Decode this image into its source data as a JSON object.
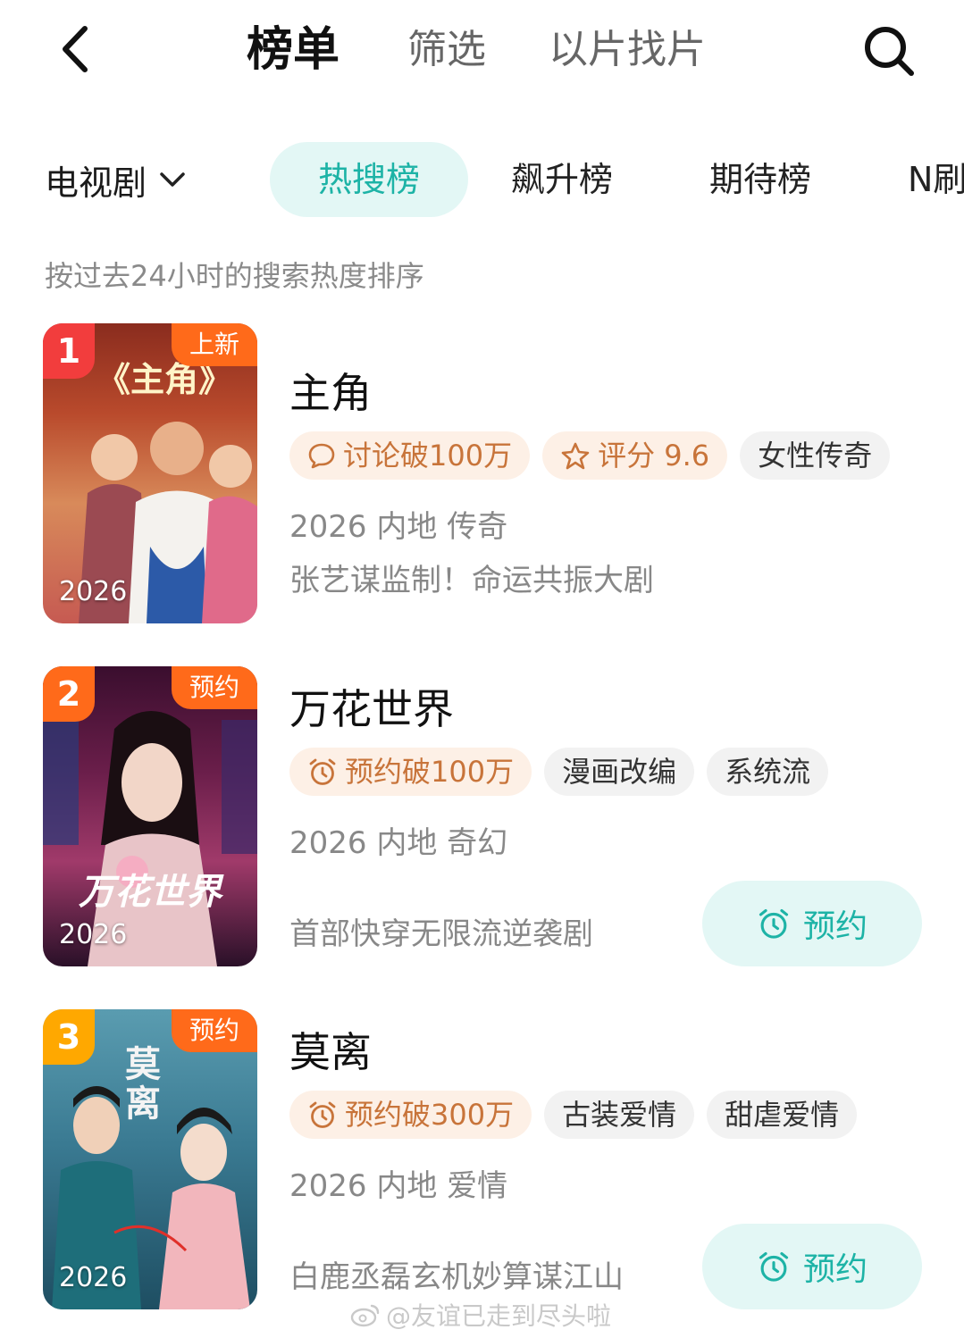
{
  "header": {
    "back_icon": "chevron-left-icon",
    "tabs": [
      "榜单",
      "筛选",
      "以片找片"
    ],
    "search_icon": "search-icon"
  },
  "categories": {
    "dropdown_label": "电视剧",
    "dropdown_icon": "chevron-down-icon",
    "items": [
      "热搜榜",
      "飙升榜",
      "期待榜",
      "N刷"
    ],
    "active": "热搜榜"
  },
  "subtitle": "按过去24小时的搜索热度排序",
  "colors": {
    "accent": "#1db3a6",
    "accent_bg": "#e3f7f5",
    "hot_tag_text": "#c8743a",
    "hot_tag_bg": "#fdf0e6",
    "rank_1": "#f23d3d",
    "rank_2": "#ff6a1a",
    "rank_3": "#ffa800",
    "corner_badge": "#ff6a1a"
  },
  "items": [
    {
      "rank": "1",
      "corner_badge": "上新",
      "poster_year": "2026",
      "poster_title": "《主角》",
      "title": "主角",
      "tags": [
        {
          "icon": "chat-bubble-icon",
          "label": "讨论破100万",
          "style": "hot"
        },
        {
          "icon": "star-icon",
          "label": "评分 9.6",
          "style": "hot"
        },
        {
          "icon": "",
          "label": "女性传奇",
          "style": "plain"
        }
      ],
      "meta": "2026 内地 传奇",
      "description": "张艺谋监制！命运共振大剧"
    },
    {
      "rank": "2",
      "corner_badge": "预约",
      "poster_year": "2026",
      "poster_title": "万花世界",
      "title": "万花世界",
      "tags": [
        {
          "icon": "alarm-clock-icon",
          "label": "预约破100万",
          "style": "hot"
        },
        {
          "icon": "",
          "label": "漫画改编",
          "style": "plain"
        },
        {
          "icon": "",
          "label": "系统流",
          "style": "plain"
        }
      ],
      "meta": "2026 内地 奇幻",
      "description": "首部快穿无限流逆袭剧",
      "reserve_label": "预约"
    },
    {
      "rank": "3",
      "corner_badge": "预约",
      "poster_year": "2026",
      "poster_title": "莫离",
      "title": "莫离",
      "tags": [
        {
          "icon": "alarm-clock-icon",
          "label": "预约破300万",
          "style": "hot"
        },
        {
          "icon": "",
          "label": "古装爱情",
          "style": "plain"
        },
        {
          "icon": "",
          "label": "甜虐爱情",
          "style": "plain"
        }
      ],
      "meta": "2026 内地 爱情",
      "description": "白鹿丞磊玄机妙算谋江山",
      "reserve_label": "预约"
    }
  ],
  "watermark": "@友谊已走到尽头啦"
}
